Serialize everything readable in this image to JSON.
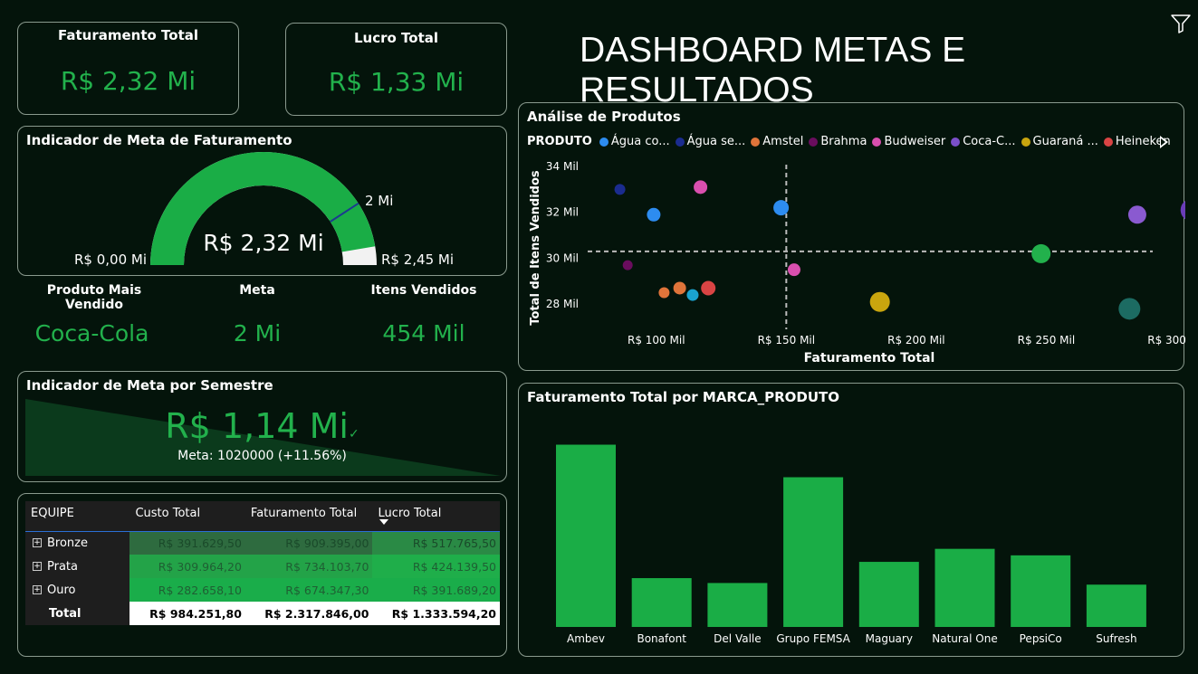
{
  "header": {
    "title": "DASHBOARD METAS E RESULTADOS"
  },
  "kpis": {
    "faturamento": {
      "title": "Faturamento Total",
      "value": "R$ 2,32 Mi"
    },
    "lucro": {
      "title": "Lucro Total",
      "value": "R$ 1,33 Mi"
    }
  },
  "gauge": {
    "title": "Indicador de Meta de Faturamento",
    "value_label": "R$ 2,32 Mi",
    "min_label": "R$ 0,00 Mi",
    "max_label": "R$ 2,45 Mi",
    "target_label": "2 Mi",
    "value": 2.32,
    "min": 0,
    "max": 2.45,
    "target": 2.0
  },
  "stats": {
    "produto_label": "Produto Mais Vendido",
    "produto_value": "Coca-Cola",
    "meta_label": "Meta",
    "meta_value": "2 Mi",
    "itens_label": "Itens Vendidos",
    "itens_value": "454 Mil"
  },
  "semestre": {
    "title": "Indicador de Meta por Semestre",
    "value": "R$ 1,14 Mi",
    "check": "✓",
    "meta_text": "Meta: 1020000 (+11.56%)"
  },
  "table": {
    "headers": [
      "EQUIPE",
      "Custo Total",
      "Faturamento Total",
      "Lucro Total"
    ],
    "rows": [
      {
        "name": "Bronze",
        "custo": "R$ 391.629,50",
        "fat": "R$ 909.395,00",
        "lucro": "R$ 517.765,50"
      },
      {
        "name": "Prata",
        "custo": "R$ 309.964,20",
        "fat": "R$ 734.103,70",
        "lucro": "R$ 424.139,50"
      },
      {
        "name": "Ouro",
        "custo": "R$ 282.658,10",
        "fat": "R$ 674.347,30",
        "lucro": "R$ 391.689,20"
      }
    ],
    "total": {
      "name": "Total",
      "custo": "R$ 984.251,80",
      "fat": "R$ 2.317.846,00",
      "lucro": "R$ 1.333.594,20"
    },
    "colors": {
      "bronze": "#2e6b3f",
      "prata": "#22a548",
      "ouro": "#1aa84a"
    }
  },
  "chart_data": [
    {
      "type": "scatter",
      "title": "Análise de Produtos",
      "legend_title": "PRODUTO",
      "legend": [
        {
          "name": "Água co...",
          "color": "#2d8cf0"
        },
        {
          "name": "Água se...",
          "color": "#1b2c8f"
        },
        {
          "name": "Amstel",
          "color": "#e0743a"
        },
        {
          "name": "Brahma",
          "color": "#6a0d5e"
        },
        {
          "name": "Budweiser",
          "color": "#d94fae"
        },
        {
          "name": "Coca-C...",
          "color": "#7b4fc9"
        },
        {
          "name": "Guaraná ...",
          "color": "#c9a50e"
        },
        {
          "name": "Heineken",
          "color": "#d94444"
        }
      ],
      "xlabel": "Faturamento Total",
      "ylabel": "Total de Itens Vendidos",
      "x_ticks": [
        "R$ 100 Mil",
        "R$ 150 Mil",
        "R$ 200 Mil",
        "R$ 250 Mil",
        "R$ 300 Mil"
      ],
      "y_ticks": [
        "34 Mil",
        "32 Mil",
        "30 Mil",
        "28 Mil"
      ],
      "xlim": [
        75,
        300
      ],
      "ylim": [
        27.3,
        34
      ],
      "x_avg": 150,
      "y_avg": 30.3,
      "points": [
        {
          "x": 86,
          "y": 33.0,
          "r": 6,
          "color": "#1b2c8f"
        },
        {
          "x": 99,
          "y": 31.9,
          "r": 7.5,
          "color": "#2d8cf0"
        },
        {
          "x": 117,
          "y": 33.1,
          "r": 7.5,
          "color": "#d94fae"
        },
        {
          "x": 148,
          "y": 32.2,
          "r": 8.5,
          "color": "#2d8cf0"
        },
        {
          "x": 285,
          "y": 31.9,
          "r": 10,
          "color": "#8a5ad0"
        },
        {
          "x": 306,
          "y": 32.1,
          "r": 12.5,
          "color": "#6a3db8"
        },
        {
          "x": 89,
          "y": 29.7,
          "r": 5.5,
          "color": "#6a0d5e"
        },
        {
          "x": 153,
          "y": 29.5,
          "r": 7,
          "color": "#d94fae"
        },
        {
          "x": 248,
          "y": 30.2,
          "r": 10.5,
          "color": "#22b14c"
        },
        {
          "x": 103,
          "y": 28.5,
          "r": 6,
          "color": "#e0743a"
        },
        {
          "x": 109,
          "y": 28.7,
          "r": 7,
          "color": "#e0743a"
        },
        {
          "x": 114,
          "y": 28.4,
          "r": 6.5,
          "color": "#1aa3d0"
        },
        {
          "x": 120,
          "y": 28.7,
          "r": 8,
          "color": "#d94444"
        },
        {
          "x": 186,
          "y": 28.1,
          "r": 11,
          "color": "#c9a50e"
        },
        {
          "x": 282,
          "y": 27.8,
          "r": 12,
          "color": "#1c6b62"
        }
      ]
    },
    {
      "type": "bar",
      "title": "Faturamento Total por MARCA_PRODUTO",
      "categories": [
        "Ambev",
        "Bonafont",
        "Del Valle",
        "Grupo FEMSA",
        "Maguary",
        "Natural One",
        "PepsiCo",
        "Sufresh"
      ],
      "values": [
        560,
        150,
        135,
        460,
        200,
        240,
        220,
        130
      ],
      "ylim": [
        0,
        600
      ],
      "color": "#1aad46"
    }
  ]
}
